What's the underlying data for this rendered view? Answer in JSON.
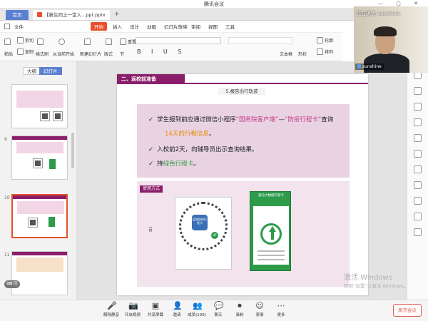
{
  "window": {
    "title": "腾讯会议",
    "controls": "— ▢ ✕"
  },
  "tabs": {
    "home": "首页",
    "doc": "【新生同上一堂入...ppt.pptx",
    "close": "×",
    "add": "+"
  },
  "menu": {
    "items": [
      "文件",
      "开始",
      "插入",
      "设计",
      "动画",
      "幻灯片放映",
      "审阅",
      "视图",
      "工具"
    ]
  },
  "ribbon": {
    "row1": [
      "粘贴",
      "剪切",
      "复制",
      "格式刷",
      "从当前开始",
      "新建幻灯片",
      "版式",
      "节",
      "重置"
    ],
    "row2": [
      "文本框",
      "形状",
      "排列",
      "轮廓"
    ]
  },
  "panel": {
    "tab_outline": "大纲",
    "tab_slides": "幻灯片",
    "thumb_numbers": [
      "9",
      "10",
      "11"
    ]
  },
  "slide": {
    "section_title": "二、返校前准备",
    "subtitle": "5.报告出行轨迹",
    "bullet1_a": "学生报到前应通过微信小程序",
    "bullet1_b": "“国务院客户端”",
    "bullet1_c": "—",
    "bullet1_d": "“防疫行程卡”",
    "bullet1_e": "查询",
    "bullet1_f": "14天的行程信息",
    "bullet1_g": "。",
    "bullet2": "入校前2天，向辅导员出示查询结果。",
    "bullet3_a": "持",
    "bullet3_b": "绿色行程卡",
    "bullet3_c": "。",
    "check": "✓",
    "usage_tag": "使用方式",
    "qr_center": "疫情防控行程卡",
    "qr_dp": "dP",
    "green_card_header": "通信大数据行程卡"
  },
  "video": {
    "speaking": "正在讲话: sunshine;",
    "name": "sunshine"
  },
  "watermark": {
    "line1": "激活 Windows",
    "line2": "转到“设置”以激活 Windows。"
  },
  "float_button": "⌨ 同",
  "toolbar": {
    "items": [
      {
        "label": "解除静音",
        "icon": "mic-icon",
        "glyph": "🎤"
      },
      {
        "label": "开启视频",
        "icon": "camera-icon",
        "glyph": "📷"
      },
      {
        "label": "共享屏幕",
        "icon": "screen-share-icon",
        "glyph": "▣"
      },
      {
        "label": "邀请",
        "icon": "invite-icon",
        "glyph": "👤"
      },
      {
        "label": "成员(100)",
        "icon": "members-icon",
        "glyph": "👥"
      },
      {
        "label": "聊天",
        "icon": "chat-icon",
        "glyph": "💬"
      },
      {
        "label": "录制",
        "icon": "record-icon",
        "glyph": "⏺"
      },
      {
        "label": "表情",
        "icon": "emoji-icon",
        "glyph": "☺"
      },
      {
        "label": "更多",
        "icon": "more-icon",
        "glyph": "⋯"
      }
    ],
    "leave": "离开会议"
  },
  "colors": {
    "accent": "#e8502a",
    "brand_purple": "#8b1e6a",
    "green": "#2c9b4a",
    "pink_text": "#c23b8a",
    "orange_text": "#e68a00"
  }
}
